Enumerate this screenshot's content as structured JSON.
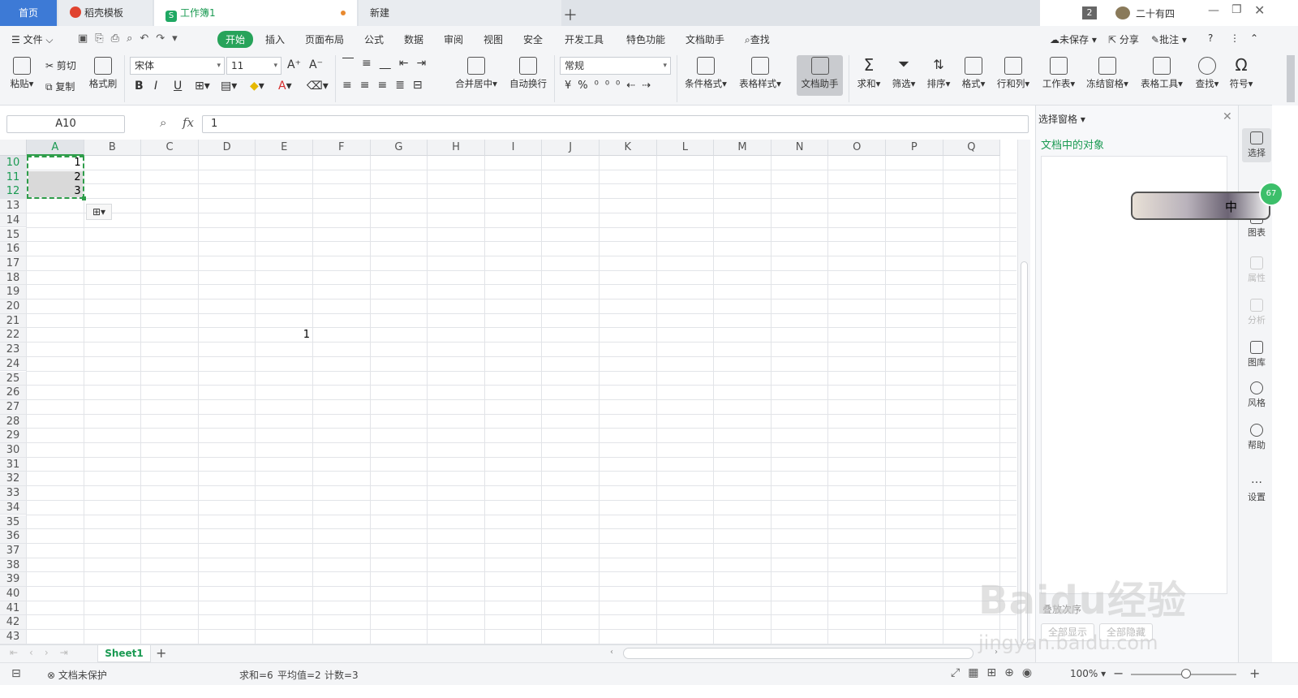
{
  "tabs": [
    {
      "label": "首页"
    },
    {
      "label": "稻壳模板"
    },
    {
      "label": "工作簿1"
    },
    {
      "label": "新建"
    }
  ],
  "titlebar": {
    "badge": "2",
    "user": "二十有四"
  },
  "menus": [
    "文件",
    "开始",
    "插入",
    "页面布局",
    "公式",
    "数据",
    "审阅",
    "视图",
    "安全",
    "开发工具",
    "特色功能",
    "文档助手",
    "查找"
  ],
  "menu_right": {
    "unsaved": "未保存",
    "share": "分享",
    "comment": "批注"
  },
  "ribbon": {
    "paste": "粘贴",
    "cut": "剪切",
    "copy": "复制",
    "format_painter": "格式刷",
    "font_name": "宋体",
    "font_size": "11",
    "merge_center": "合并居中",
    "wrap_text": "自动换行",
    "number_format": "常规",
    "cond_format": "条件格式",
    "table_style": "表格样式",
    "doc_assistant": "文档助手",
    "sum": "求和",
    "filter": "筛选",
    "sort": "排序",
    "format": "格式",
    "row_col": "行和列",
    "worksheet": "工作表",
    "freeze": "冻结窗格",
    "table_tools": "表格工具",
    "find": "查找",
    "symbol": "符号"
  },
  "formula_bar": {
    "name_box": "A10",
    "fx": "fx",
    "value": "1"
  },
  "grid": {
    "columns": [
      "A",
      "B",
      "C",
      "D",
      "E",
      "F",
      "G",
      "H",
      "I",
      "J",
      "K",
      "L",
      "M",
      "N",
      "O",
      "P",
      "Q"
    ],
    "rows": [
      "10",
      "11",
      "12",
      "13",
      "14",
      "15",
      "16",
      "17",
      "18",
      "19",
      "20",
      "21",
      "22",
      "23",
      "24",
      "25",
      "26",
      "27",
      "28",
      "29",
      "30",
      "31",
      "32",
      "33",
      "34",
      "35",
      "36",
      "37",
      "38",
      "39",
      "40",
      "41",
      "42",
      "43"
    ],
    "cells": [
      {
        "ref": "A10",
        "value": "1"
      },
      {
        "ref": "A11",
        "value": "2"
      },
      {
        "ref": "A12",
        "value": "3"
      },
      {
        "ref": "E22",
        "value": "1"
      }
    ]
  },
  "sheet_tabs": [
    "Sheet1"
  ],
  "status": {
    "protect": "文档未保护",
    "sum": "求和=6",
    "avg": "平均值=2",
    "count": "计数=3",
    "zoom": "100%"
  },
  "pane": {
    "title": "选择窗格",
    "section": "文档中的对象",
    "order_label": "叠放次序",
    "show_all": "全部显示",
    "hide_all": "全部隐藏"
  },
  "rail": [
    "选择",
    "图表",
    "属性",
    "分析",
    "图库",
    "风格",
    "帮助",
    "设置"
  ],
  "float_badge": {
    "char": "中",
    "number": "67"
  },
  "watermark": {
    "brand": "Baidu经验",
    "url": "jingyan.baidu.com"
  },
  "colors": {
    "accent_green": "#27a35a",
    "home_tab": "#3d7ad6",
    "selection_border": "#2e9d4a"
  }
}
